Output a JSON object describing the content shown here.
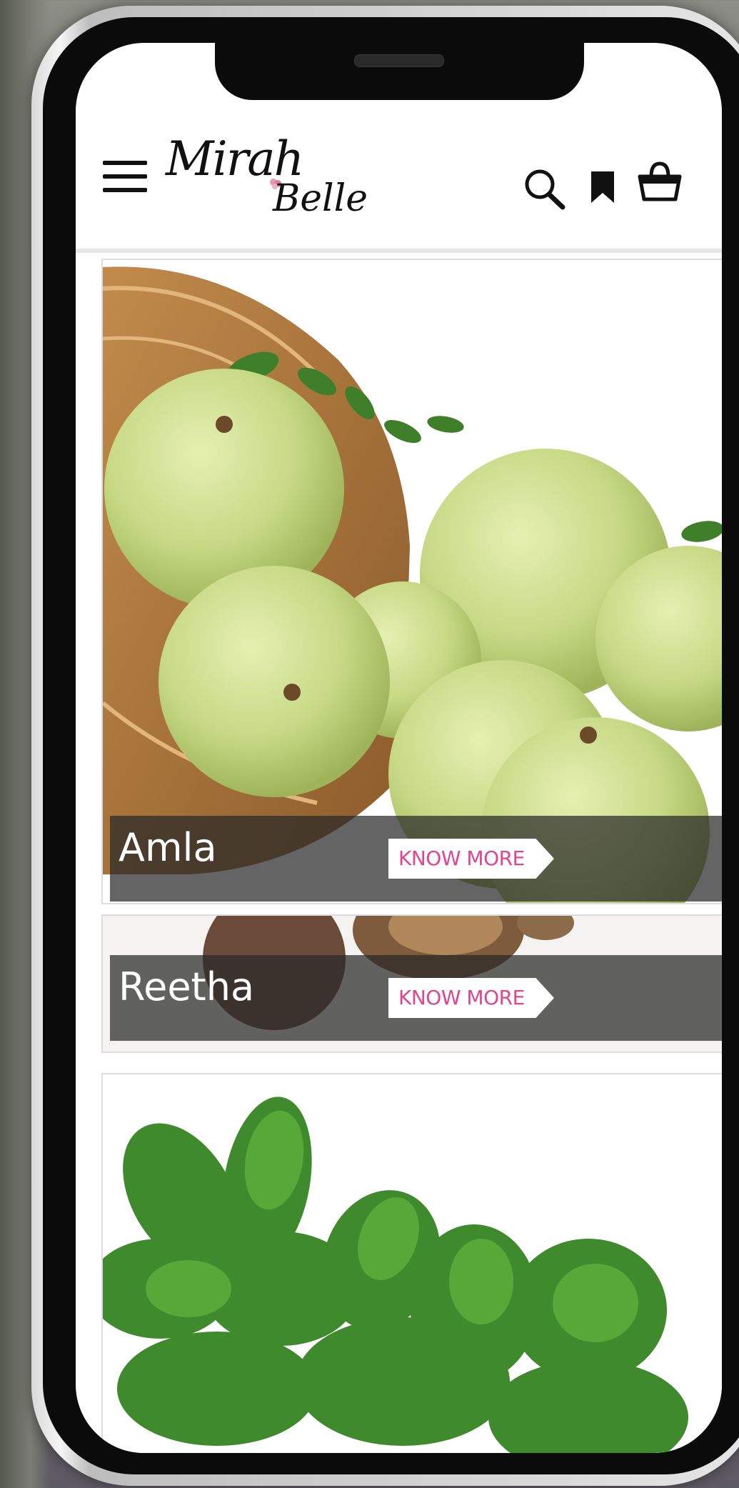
{
  "header": {
    "brand_line1": "Mirah",
    "brand_line2": "Belle",
    "icons": [
      "hamburger-icon",
      "search-icon",
      "bookmark-icon",
      "shopping-bag-icon"
    ]
  },
  "products": [
    {
      "name": "Amla",
      "cta": "KNOW MORE"
    },
    {
      "name": "Reetha",
      "cta": "KNOW MORE"
    }
  ],
  "colors": {
    "cta_text": "#e0458f",
    "caption_bar": "#282828",
    "background": "#ffffff"
  }
}
